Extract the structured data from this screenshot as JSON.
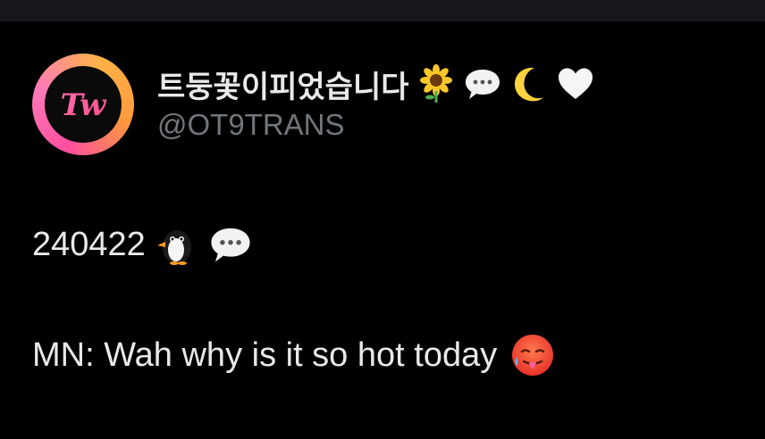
{
  "profile": {
    "display_name": "트둥꽃이피었습니다",
    "handle": "@OT9TRANS",
    "avatar_logo_text": "Tw",
    "name_emojis": [
      "sunflower-emoji",
      "speech-bubble-emoji",
      "crescent-moon-emoji",
      "white-heart-emoji"
    ]
  },
  "tweet": {
    "line1_text": "240422",
    "line1_emojis": [
      "penguin-emoji",
      "speech-bubble-emoji"
    ],
    "line2_text": "MN: Wah why is it so hot today",
    "line2_emojis": [
      "hot-face-emoji"
    ]
  },
  "colors": {
    "background": "#000000",
    "text_primary": "#e7e9ea",
    "text_secondary": "#71767b",
    "avatar_ring": "#ff4fa0"
  }
}
